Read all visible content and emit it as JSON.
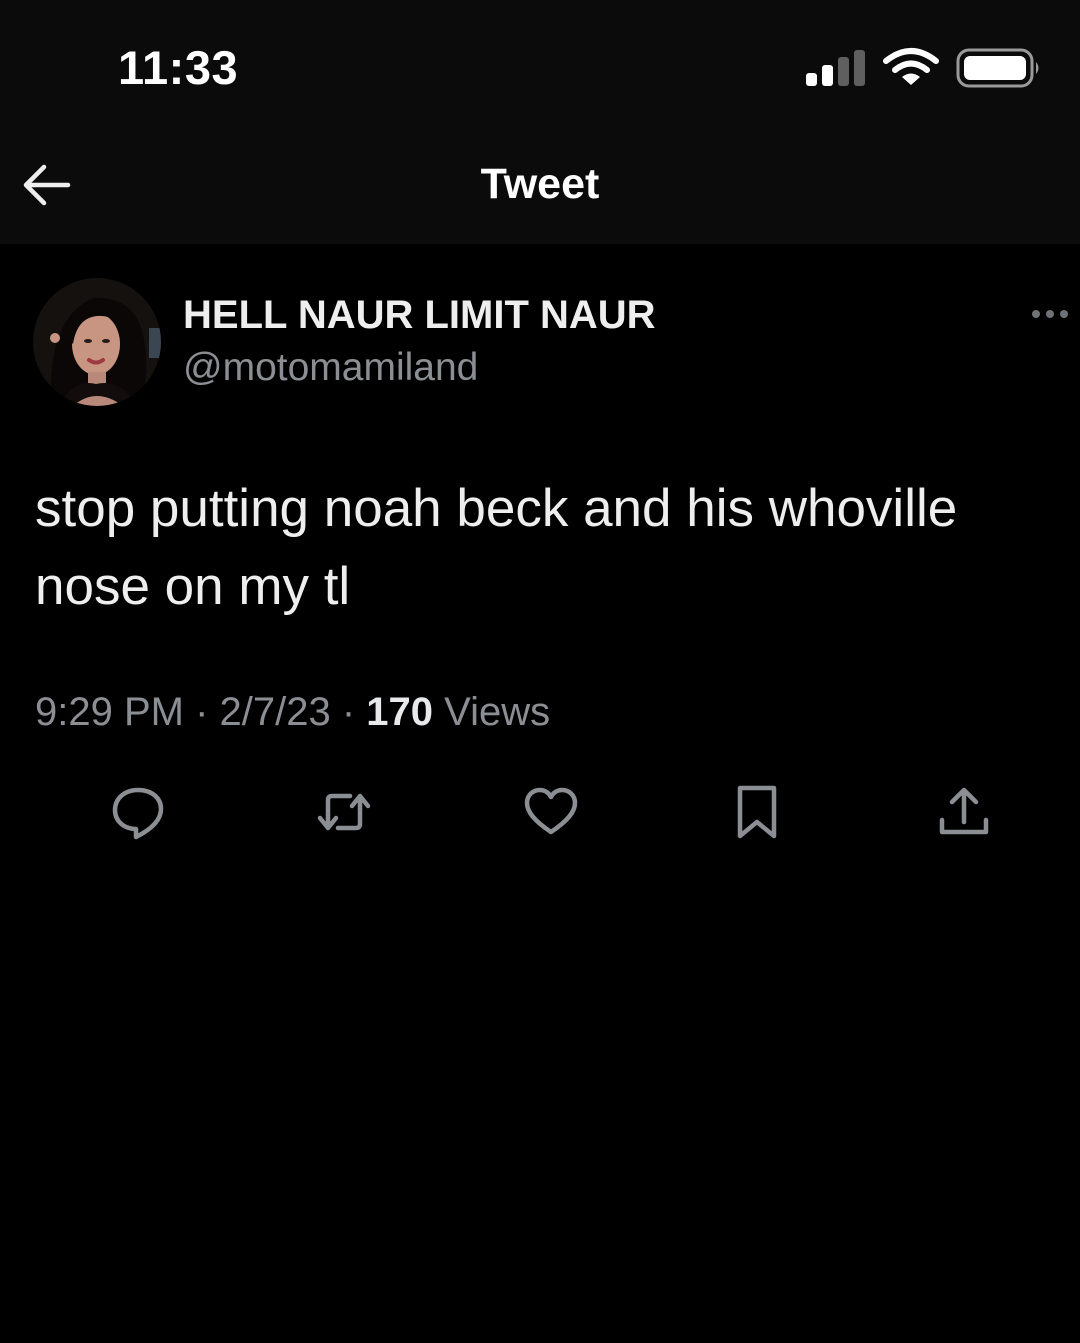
{
  "status_bar": {
    "time": "11:33",
    "icons": [
      "cellular-signal-icon",
      "wifi-icon",
      "battery-icon"
    ]
  },
  "header": {
    "back_icon": "back-arrow-icon",
    "title": "Tweet"
  },
  "tweet": {
    "author": {
      "display_name": "HELL NAUR LIMIT NAUR",
      "handle": "@motomamiland"
    },
    "more_icon": "more-options-icon",
    "text": "stop putting noah beck and his whoville nose on my tl",
    "meta": {
      "time": "9:29 PM",
      "separator": " · ",
      "date": "2/7/23",
      "views_count": "170",
      "views_label": "Views"
    },
    "actions": [
      "reply-icon",
      "retweet-icon",
      "like-icon",
      "bookmark-icon",
      "share-icon"
    ]
  },
  "colors": {
    "background": "#000000",
    "header_background": "#0b0b0b",
    "primary_text": "#e7e9ea",
    "secondary_text": "#8b8f94",
    "icon": "#8b8f94"
  }
}
